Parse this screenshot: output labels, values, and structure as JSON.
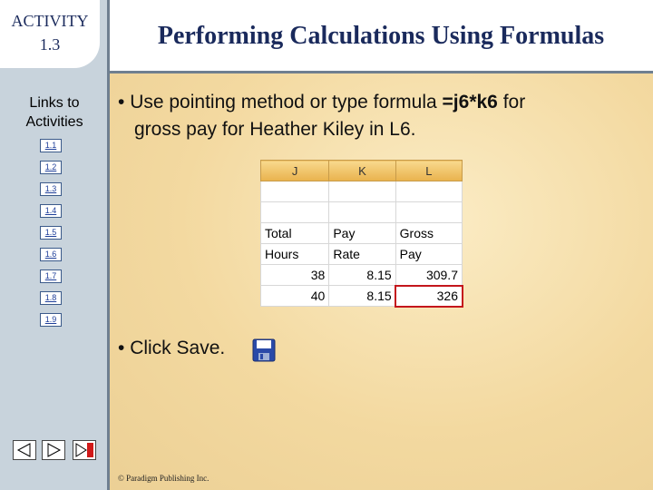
{
  "activity": {
    "line1": "ACTIVITY",
    "line2": "1.3"
  },
  "sidebar": {
    "links_title_1": "Links to",
    "links_title_2": "Activities",
    "links": [
      "1.1",
      "1.2",
      "1.3",
      "1.4",
      "1.5",
      "1.6",
      "1.7",
      "1.8",
      "1.9"
    ]
  },
  "header": {
    "title": "Performing Calculations Using Formulas"
  },
  "bullets": {
    "b1_pre": "Use pointing method or type formula ",
    "b1_formula": "=j6*k6",
    "b1_post": " for",
    "b1_line2": "gross pay for Heather Kiley in L6.",
    "b2": "Click Save."
  },
  "sheet": {
    "columns": [
      "J",
      "K",
      "L"
    ],
    "rows": [
      [
        "",
        "",
        ""
      ],
      [
        "",
        "",
        ""
      ],
      [
        "Total",
        "Pay",
        "Gross"
      ],
      [
        "Hours",
        "Rate",
        "Pay"
      ],
      [
        "38",
        "8.15",
        "309.7"
      ],
      [
        "40",
        "8.15",
        "326"
      ]
    ]
  },
  "footer": {
    "copyright": "© Paradigm Publishing Inc."
  },
  "colors": {
    "accent": "#1a2a5c",
    "selection": "#c4161c",
    "header_fill": "#f3c469"
  }
}
